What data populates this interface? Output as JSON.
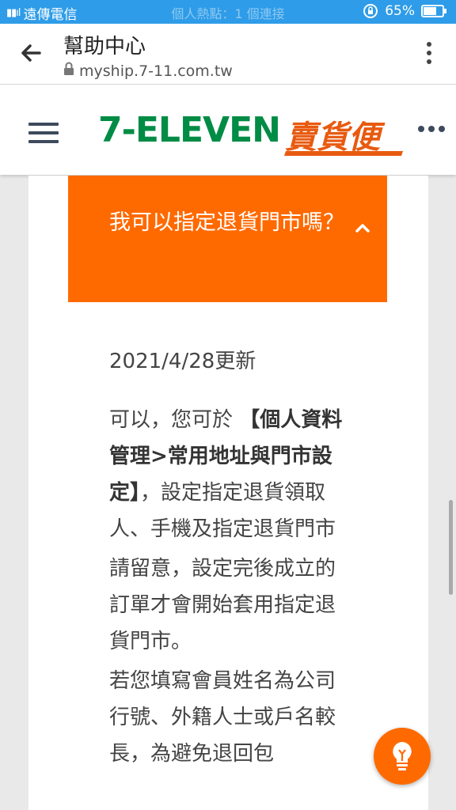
{
  "status_bar": {
    "carrier": "遠傳電信",
    "hotspot_text": "個人熱點：1 個連接",
    "battery": "65%"
  },
  "browser": {
    "page_title": "幫助中心",
    "url": "myship.7-11.com.tw"
  },
  "site_header": {
    "brand": "7-ELEVEN",
    "service_name": "賣貨便"
  },
  "faq": {
    "question": "我可以指定退貨門市嗎？",
    "updated": "2021/4/28更新",
    "answer_p1_prefix": "可以，您可於 ",
    "answer_p1_bold": "【個人資料管理>常用地址與門市設定】",
    "answer_p1_suffix": "，設定指定退貨領取人、手機及指定退貨門市",
    "answer_p2": "請留意，設定完後成立的訂單才會開始套用指定退貨門市。",
    "answer_p3": "若您填寫會員姓名為公司行號、外籍人士或戶名較長，為避免退回包"
  },
  "colors": {
    "accent": "#ff6a00",
    "status_bar": "#2e9ce8",
    "brand_green": "#008c45"
  },
  "icons": [
    "back-arrow-icon",
    "lock-icon",
    "kebab-menu-icon",
    "hamburger-icon",
    "more-dots-icon",
    "chevron-up-icon",
    "lightbulb-icon"
  ]
}
